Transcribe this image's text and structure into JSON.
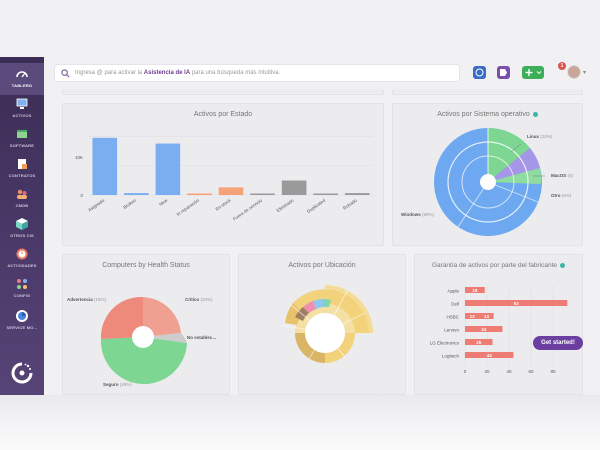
{
  "sidebar": {
    "items": [
      {
        "label": "TABLERO",
        "icon": "dashboard-icon"
      },
      {
        "label": "ACTIVOS",
        "icon": "monitor-icon"
      },
      {
        "label": "SOFTWARE",
        "icon": "software-box-icon"
      },
      {
        "label": "CONTRATOS",
        "icon": "contract-document-icon"
      },
      {
        "label": "CMDB",
        "icon": "cmdb-users-icon"
      },
      {
        "label": "OTROS CIS",
        "icon": "cube-icon"
      },
      {
        "label": "ACTIVIDADES",
        "icon": "clock-icon"
      },
      {
        "label": "CONFIG",
        "icon": "network-config-icon"
      },
      {
        "label": "SERVICE MO...",
        "icon": "service-management-icon"
      }
    ]
  },
  "search": {
    "placeholder_pre": "Ingresa @ para activar la ",
    "placeholder_bold": "Asistencia de IA",
    "placeholder_post": " para una búsqueda más intuitiva."
  },
  "header": {
    "notification_count": "1"
  },
  "colors": {
    "blue": "#6ea8f0",
    "red": "#ee7b74",
    "orange": "#f5a279",
    "grey": "#8f8f8f",
    "green": "#7ed693",
    "purple": "#a596e8",
    "yellow": "#f2d27a",
    "brand": "#6b3fa0"
  },
  "cards": {
    "estado": {
      "title": "Activos por Estado",
      "chart_data": {
        "type": "bar",
        "categories": [
          "Asignado",
          "Broken",
          "New",
          "In reparación",
          "En stock",
          "Fuera de servicio",
          "Eliminado",
          "Duplicated",
          "Robado"
        ],
        "values": [
          15,
          0.5,
          13.5,
          0.3,
          2,
          0.3,
          3.8,
          0.2,
          0.5
        ],
        "colors": [
          "#7aaef0",
          "#7aaef0",
          "#7aaef0",
          "#f5a279",
          "#f5a279",
          "#9a9a9a",
          "#9a9a9a",
          "#9a9a9a",
          "#9a9a9a"
        ],
        "yticks": [
          "10K",
          "0"
        ],
        "ylim": [
          0,
          16
        ]
      }
    },
    "so": {
      "title": "Activos por Sistema operativo",
      "labels": {
        "linux": "Linux",
        "linux_pct": "(20%)",
        "macos": "MacOS",
        "macos_pct": "(6)",
        "otro": "Otro",
        "otro_pct": "(5%)",
        "windows": "Windows",
        "windows_pct": "(69%)"
      },
      "chart_data": {
        "type": "pie",
        "labels": [
          "Windows",
          "Linux",
          "MacOS",
          "Otro"
        ],
        "values": [
          69,
          20,
          6,
          5
        ],
        "colors": [
          "#6ea8f0",
          "#7ed693",
          "#a596e8",
          "#8fdca0"
        ]
      }
    },
    "health": {
      "title": "Computers by Health Status",
      "labels": {
        "adv": "Advertencia",
        "adv_pct": "(16%)",
        "crit": "Crítico",
        "crit_pct": "(24%)",
        "noest": "No establec...",
        "seg": "Seguro",
        "seg_pct": "(49%)"
      },
      "chart_data": {
        "type": "pie",
        "labels": [
          "Seguro",
          "Advertencia",
          "Crítico",
          "No establecido"
        ],
        "values": [
          49,
          16,
          24,
          11
        ],
        "colors": [
          "#7ed693",
          "#ee8a7c",
          "#f0a091",
          "#cccccc"
        ]
      }
    },
    "ubicacion": {
      "title": "Activos por Ubicación"
    },
    "garantia": {
      "title": "Garantía de activos por parte del fabricante",
      "chart_data": {
        "type": "bar",
        "categories": [
          "Apple",
          "Dell",
          "HSBC",
          "Lenovo",
          "LG Electronics",
          "Logitech"
        ],
        "series": [
          {
            "values": [
              "18",
              "",
              "",
              "",
              "",
              ""
            ]
          },
          {
            "values": [
              "",
              "93",
              "",
              "",
              "",
              ""
            ]
          },
          {
            "values": [
              "",
              "",
              "13",
              "",
              "",
              ""
            ]
          },
          {
            "values": [
              "",
              "",
              "13",
              "",
              "",
              ""
            ]
          },
          {
            "values": [
              "",
              "",
              "",
              "34",
              "",
              ""
            ]
          },
          {
            "values": [
              "",
              "",
              "",
              "",
              "25",
              ""
            ]
          },
          {
            "values": [
              "",
              "",
              "",
              "",
              "",
              "44"
            ]
          }
        ],
        "bars": [
          18,
          93,
          26,
          34,
          25,
          44
        ],
        "xticks": [
          "0",
          "20",
          "40",
          "60",
          "80"
        ],
        "xlim": [
          0,
          100
        ]
      }
    }
  },
  "cta": {
    "label": "Get started!"
  }
}
